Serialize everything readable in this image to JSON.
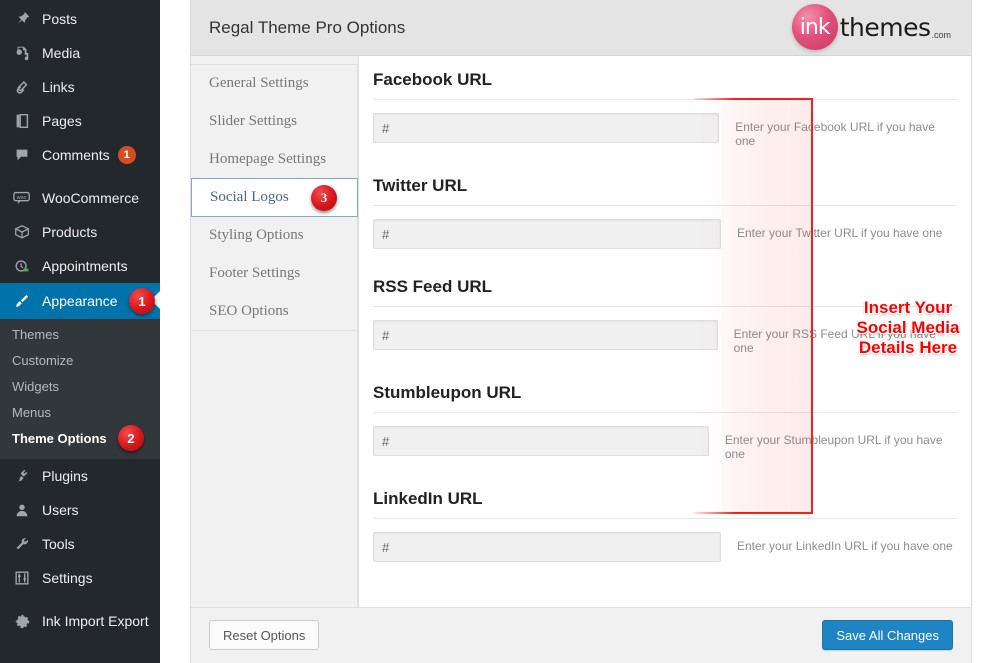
{
  "admin_menu": {
    "items": [
      {
        "label": "Posts",
        "icon": "pin-icon",
        "badge": null,
        "current": false
      },
      {
        "label": "Media",
        "icon": "media-icon",
        "badge": null,
        "current": false
      },
      {
        "label": "Links",
        "icon": "link-icon",
        "badge": null,
        "current": false
      },
      {
        "label": "Pages",
        "icon": "pages-icon",
        "badge": null,
        "current": false
      },
      {
        "label": "Comments",
        "icon": "comment-icon",
        "badge": "1",
        "current": false
      },
      {
        "label": "WooCommerce",
        "icon": "woocommerce-icon",
        "badge": null,
        "current": false
      },
      {
        "label": "Products",
        "icon": "box-icon",
        "badge": null,
        "current": false
      },
      {
        "label": "Appointments",
        "icon": "appointments-icon",
        "badge": null,
        "current": false
      },
      {
        "label": "Appearance",
        "icon": "brush-icon",
        "badge": null,
        "current": true
      },
      {
        "label": "Plugins",
        "icon": "plug-icon",
        "badge": null,
        "current": false
      },
      {
        "label": "Users",
        "icon": "user-icon",
        "badge": null,
        "current": false
      },
      {
        "label": "Tools",
        "icon": "wrench-icon",
        "badge": null,
        "current": false
      },
      {
        "label": "Settings",
        "icon": "sliders-icon",
        "badge": null,
        "current": false
      },
      {
        "label": "Ink Import Export",
        "icon": "gear-icon",
        "badge": null,
        "current": false
      }
    ],
    "submenu": [
      {
        "label": "Themes",
        "current": false
      },
      {
        "label": "Customize",
        "current": false
      },
      {
        "label": "Widgets",
        "current": false
      },
      {
        "label": "Menus",
        "current": false
      },
      {
        "label": "Theme Options",
        "current": true
      }
    ],
    "step_badges": {
      "appearance": "1",
      "theme_options": "2",
      "social_logos": "3"
    },
    "colors": {
      "menu_bg": "#23282d",
      "submenu_bg": "#32373c",
      "current_bg": "#0073aa",
      "bubble": "#d54e21",
      "badge": "#d8151b"
    }
  },
  "header": {
    "title": "Regal Theme Pro Options",
    "logo": {
      "mark": "ink",
      "word": "themes",
      "suffix": ".com",
      "color": "#e2517c"
    }
  },
  "tabs": [
    {
      "label": "General Settings",
      "active": false
    },
    {
      "label": "Slider Settings",
      "active": false
    },
    {
      "label": "Homepage Settings",
      "active": false
    },
    {
      "label": "Social Logos",
      "active": true
    },
    {
      "label": "Styling Options",
      "active": false
    },
    {
      "label": "Footer Settings",
      "active": false
    },
    {
      "label": "SEO Options",
      "active": false
    }
  ],
  "fields": [
    {
      "title": "Facebook URL",
      "value": "#",
      "desc": "Enter your Facebook URL if you have one"
    },
    {
      "title": "Twitter URL",
      "value": "#",
      "desc": "Enter your Twitter URL if you have one"
    },
    {
      "title": "RSS Feed URL",
      "value": "#",
      "desc": "Enter your RSS Feed URL if you have one"
    },
    {
      "title": "Stumbleupon URL",
      "value": "#",
      "desc": "Enter your Stumbleupon URL if you have one"
    },
    {
      "title": "LinkedIn URL",
      "value": "#",
      "desc": "Enter your LinkedIn URL if you have one"
    }
  ],
  "annotation": {
    "text": "Insert Your\nSocial Media\nDetails Here",
    "color": "#ff0000"
  },
  "footer": {
    "reset_label": "Reset Options",
    "save_label": "Save All Changes",
    "save_color": "#1e84c3"
  }
}
